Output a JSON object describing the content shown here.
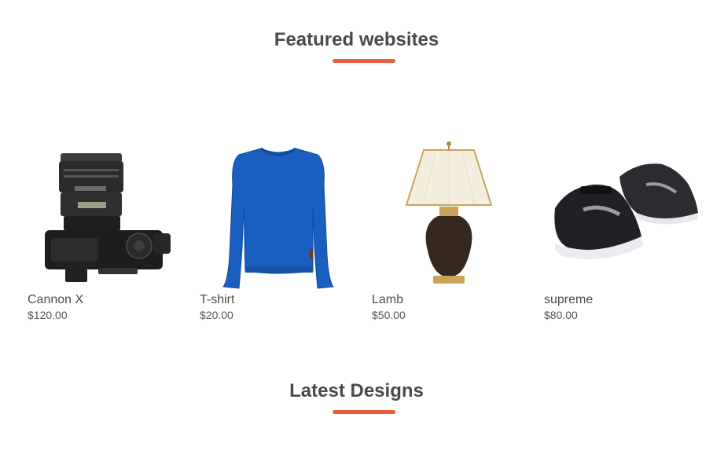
{
  "featured": {
    "title": "Featured websites",
    "accent_color": "#ee5a3d"
  },
  "products": [
    {
      "name": "Cannon X",
      "price": "$120.00",
      "image_icon": "camera-image"
    },
    {
      "name": "T-shirt",
      "price": "$20.00",
      "image_icon": "sweater-image"
    },
    {
      "name": "Lamb",
      "price": "$50.00",
      "image_icon": "lamp-image"
    },
    {
      "name": "supreme",
      "price": "$80.00",
      "image_icon": "sneakers-image"
    }
  ],
  "latest": {
    "title": "Latest Designs"
  }
}
